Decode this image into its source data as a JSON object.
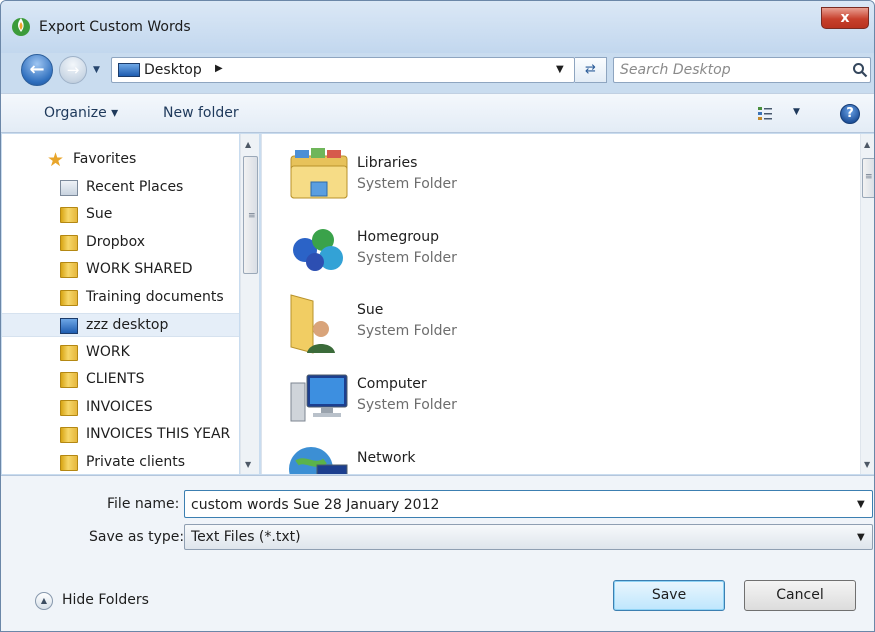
{
  "window": {
    "title": "Export Custom Words",
    "close_label": "x"
  },
  "address": {
    "location": "Desktop"
  },
  "search": {
    "placeholder": "Search Desktop"
  },
  "toolbar": {
    "organize_label": "Organize ▾",
    "new_folder_label": "New folder"
  },
  "nav": {
    "favorites_label": "Favorites",
    "items": [
      {
        "label": "Recent Places",
        "icon": "recent-places-icon"
      },
      {
        "label": "Sue",
        "icon": "folder-icon"
      },
      {
        "label": "Dropbox",
        "icon": "folder-icon"
      },
      {
        "label": "WORK SHARED",
        "icon": "folder-icon"
      },
      {
        "label": "Training documents",
        "icon": "folder-icon"
      },
      {
        "label": "zzz desktop",
        "icon": "desktop-icon",
        "selected": true
      },
      {
        "label": "WORK",
        "icon": "folder-icon"
      },
      {
        "label": "CLIENTS",
        "icon": "folder-icon"
      },
      {
        "label": "INVOICES",
        "icon": "folder-icon"
      },
      {
        "label": "INVOICES THIS YEAR",
        "icon": "folder-icon"
      },
      {
        "label": "Private clients",
        "icon": "folder-icon"
      }
    ]
  },
  "content": {
    "items": [
      {
        "name": "Libraries",
        "type": "System Folder",
        "icon": "libraries-icon"
      },
      {
        "name": "Homegroup",
        "type": "System Folder",
        "icon": "homegroup-icon"
      },
      {
        "name": "Sue",
        "type": "System Folder",
        "icon": "user-folder-icon"
      },
      {
        "name": "Computer",
        "type": "System Folder",
        "icon": "computer-icon"
      },
      {
        "name": "Network",
        "type": "",
        "icon": "network-icon"
      }
    ]
  },
  "form": {
    "file_name_label": "File name:",
    "file_name_value": "custom words Sue 28 January 2012",
    "save_type_label": "Save as type:",
    "save_type_value": "Text Files (*.txt)"
  },
  "footer": {
    "hide_folders_label": "Hide Folders",
    "save_label": "Save",
    "cancel_label": "Cancel"
  },
  "colors": {
    "title_bar": "#c9dcef",
    "accent": "#3c7fb1",
    "close": "#c7402c"
  }
}
